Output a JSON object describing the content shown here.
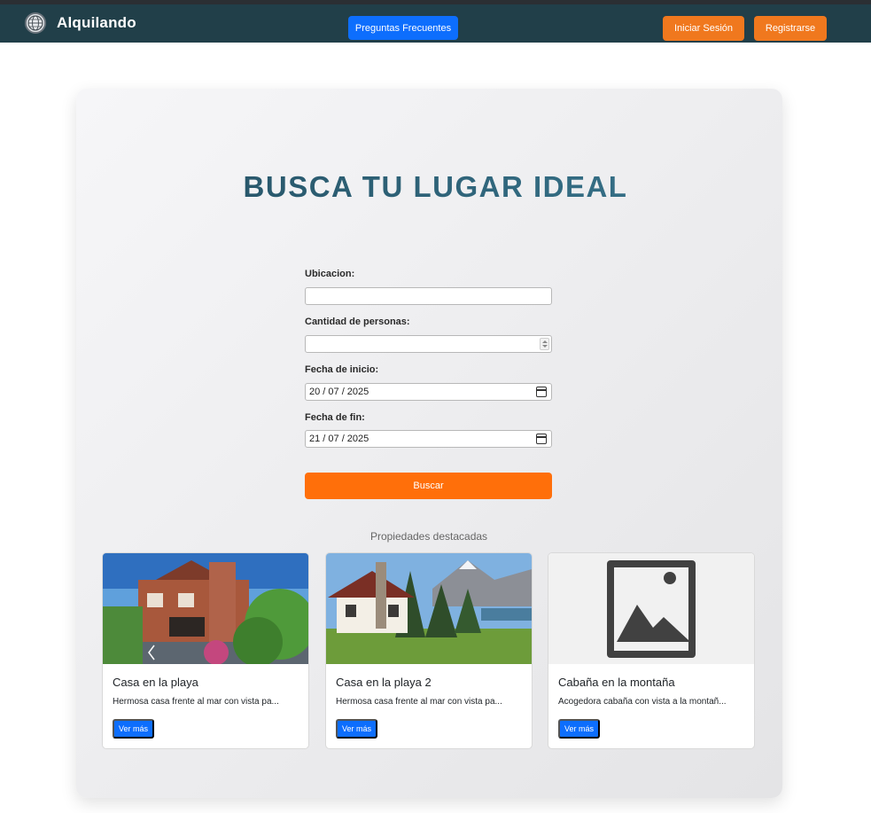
{
  "nav": {
    "brand": "Alquilando",
    "logo_icon": "globe-icon",
    "faq_label": "Preguntas Frecuentes",
    "login_label": "Iniciar Sesión",
    "register_label": "Registrarse"
  },
  "hero": {
    "title": "BUSCA TU LUGAR IDEAL"
  },
  "form": {
    "location_label": "Ubicacion:",
    "location_value": "",
    "people_label": "Cantidad de personas:",
    "people_value": "",
    "start_label": "Fecha de inicio:",
    "start_value": "20 / 07 / 2025",
    "end_label": "Fecha de fin:",
    "end_value": "21 / 07 / 2025",
    "submit_label": "Buscar"
  },
  "featured": {
    "title": "Propiedades destacadas",
    "properties": [
      {
        "title": "Casa en la playa",
        "description": "Hermosa casa frente al mar con vista pa...",
        "button": "Ver más",
        "image": "house-photo"
      },
      {
        "title": "Casa en la playa 2",
        "description": "Hermosa casa frente al mar con vista pa...",
        "button": "Ver más",
        "image": "mountain-cabin-photo"
      },
      {
        "title": "Cabaña en la montaña",
        "description": "Acogedora cabaña con vista a la montañ...",
        "button": "Ver más",
        "image": "image-placeholder-icon"
      }
    ]
  },
  "colors": {
    "navbar": "#213f49",
    "primary": "#0d6efd",
    "accent": "#f0781e",
    "search_button": "#ff6f0a"
  }
}
